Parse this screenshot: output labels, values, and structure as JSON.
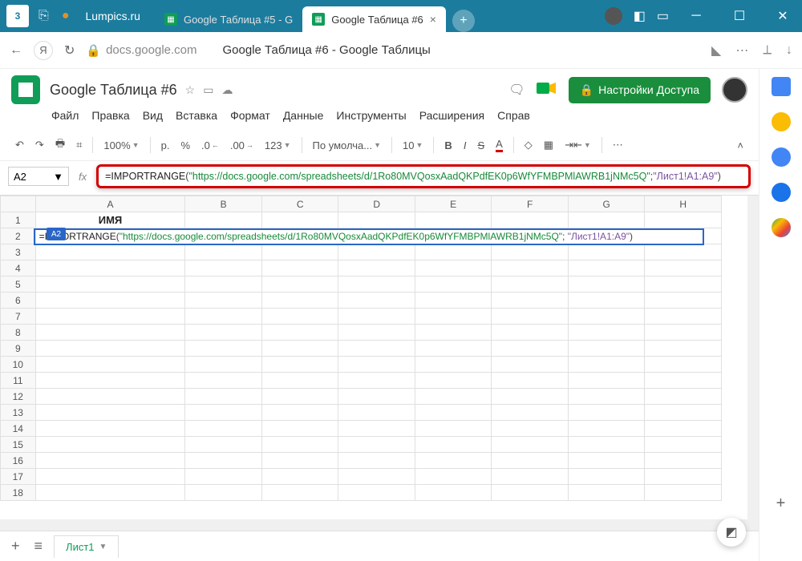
{
  "titlebar": {
    "home_badge": "3",
    "site": "Lumpics.ru",
    "tabs": [
      {
        "title": "Google Таблица #5 - G",
        "active": false
      },
      {
        "title": "Google Таблица #6",
        "active": true
      }
    ]
  },
  "addrbar": {
    "domain": "docs.google.com",
    "page_title": "Google Таблица #6 - Google Таблицы"
  },
  "doc": {
    "title": "Google Таблица #6",
    "share_label": "Настройки Доступа"
  },
  "menubar": [
    "Файл",
    "Правка",
    "Вид",
    "Вставка",
    "Формат",
    "Данные",
    "Инструменты",
    "Расширения",
    "Справ"
  ],
  "toolbar": {
    "zoom": "100%",
    "currency": "р.",
    "pct": "%",
    "dec_dec": ".0",
    "dec_inc": ".00",
    "numfmt": "123",
    "font": "По умолча...",
    "size": "10"
  },
  "name_box": "A2",
  "active_cell_badge": "A2",
  "formula": {
    "fn": "=IMPORTRANGE",
    "open": "(",
    "url": "\"https://docs.google.com/spreadsheets/d/1Ro80MVQosxAadQKPdfEK0p6WfYFMBPMlAWRB1jNMc5Q\"",
    "sep": "; ",
    "range": "\"Лист1!A1:A9\"",
    "close": ")"
  },
  "columns": [
    "A",
    "B",
    "C",
    "D",
    "E",
    "F",
    "G",
    "H"
  ],
  "rows": [
    1,
    2,
    3,
    4,
    5,
    6,
    7,
    8,
    9,
    10,
    11,
    12,
    13,
    14,
    15,
    16,
    17,
    18
  ],
  "cells": {
    "A1": "ИМЯ"
  },
  "sheet_tab": "Лист1"
}
